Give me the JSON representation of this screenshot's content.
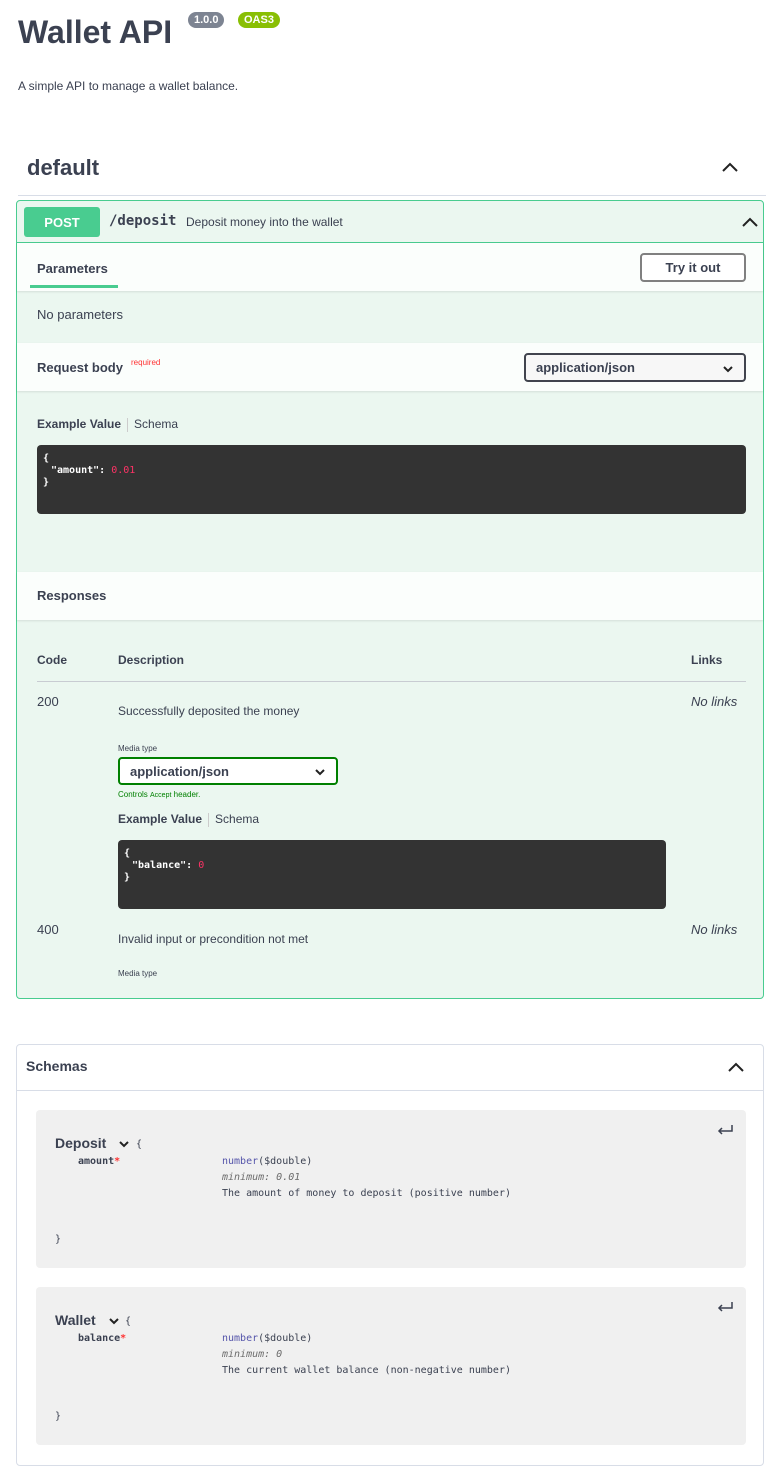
{
  "info": {
    "title": "Wallet API",
    "version": "1.0.0",
    "oas": "OAS3",
    "description": "A simple API to manage a wallet balance."
  },
  "tag": {
    "name": "default"
  },
  "operation": {
    "method": "POST",
    "path": "/deposit",
    "summary": "Deposit money into the wallet",
    "parameters": {
      "tab_label": "Parameters",
      "try_button": "Try it out",
      "empty_text": "No parameters"
    },
    "request_body": {
      "label": "Request body",
      "required_label": "required",
      "content_type": "application/json",
      "example_tab": "Example Value",
      "schema_tab": "Schema",
      "example": {
        "open": "{",
        "key": "\"amount\": ",
        "value": "0.01",
        "close": "}"
      }
    },
    "responses": {
      "label": "Responses",
      "headers": {
        "code": "Code",
        "description": "Description",
        "links": "Links"
      },
      "items": [
        {
          "code": "200",
          "description": "Successfully deposited the money",
          "links": "No links",
          "media_type_label": "Media type",
          "media_type": "application/json",
          "controls_prefix": "Controls ",
          "controls_code": "Accept",
          "controls_suffix": " header.",
          "example_tab": "Example Value",
          "schema_tab": "Schema",
          "example": {
            "open": "{",
            "key": "\"balance\": ",
            "value": "0",
            "close": "}"
          }
        },
        {
          "code": "400",
          "description": "Invalid input or precondition not met",
          "links": "No links",
          "media_type_label": "Media type"
        }
      ]
    }
  },
  "schemas": {
    "title": "Schemas",
    "models": [
      {
        "name": "Deposit",
        "open_brace": "{",
        "close_brace": "}",
        "property": "amount",
        "required_mark": "*",
        "type": "number",
        "format": "($double)",
        "minimum": "minimum: 0.01",
        "description": "The amount of money to deposit (positive number)"
      },
      {
        "name": "Wallet",
        "open_brace": "{",
        "close_brace": "}",
        "property": "balance",
        "required_mark": "*",
        "type": "number",
        "format": "($double)",
        "minimum": "minimum: 0",
        "description": "The current wallet balance (non-negative number)"
      }
    ]
  },
  "colors": {
    "post": "#49cc90",
    "post_bg": "#ebf7f0",
    "version_badge": "#7d8492",
    "oas_badge": "#89bf04",
    "required": "#ff3333",
    "code_bg": "#333333",
    "type": "#55a"
  },
  "icons": {
    "collapse": "chevron-up-icon",
    "dropdown": "chevron-down-icon",
    "expand_model": "return-arrow-icon"
  }
}
